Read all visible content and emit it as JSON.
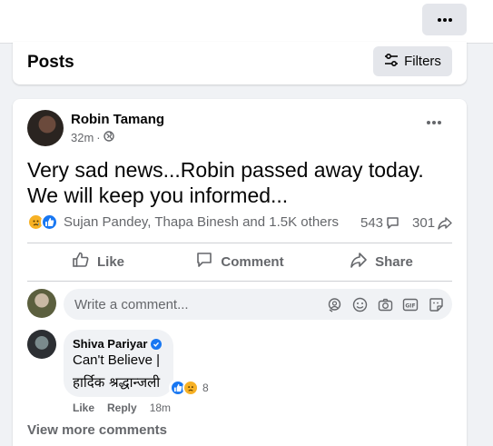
{
  "topbar": {
    "more_icon": "more-horizontal-icon"
  },
  "posts_header": {
    "title": "Posts",
    "filters_label": "Filters",
    "filters_icon": "sliders-icon"
  },
  "post": {
    "author": "Robin Tamang",
    "time": "32m",
    "privacy_icon": "globe-icon",
    "separator": "·",
    "text_line1": "Very sad news...Robin passed away today.",
    "text_line2": "We will keep you informed...",
    "reaction_icons": [
      "sad-reaction-icon",
      "like-reaction-icon"
    ],
    "reactors": "Sujan Pandey, Thapa Binesh and 1.5K others",
    "comment_count": "543",
    "share_count": "301"
  },
  "actions": {
    "like": "Like",
    "comment": "Comment",
    "share": "Share"
  },
  "composer": {
    "placeholder": "Write a comment...",
    "icons": [
      "avatar-sticker-icon",
      "emoji-icon",
      "camera-icon",
      "gif-icon",
      "sticker-icon"
    ]
  },
  "comment": {
    "author": "Shiva Pariyar",
    "verified": true,
    "line1": "Can't Believe |",
    "line2": "हार्दिक श्रद्धान्जली",
    "reaction_count": "8",
    "like_action": "Like",
    "reply_action": "Reply",
    "time": "18m"
  },
  "view_more": "View more comments",
  "colors": {
    "accent": "#1877f2",
    "sad": "#f7b125",
    "secondary_text": "#65676b",
    "background": "#f0f2f5"
  }
}
